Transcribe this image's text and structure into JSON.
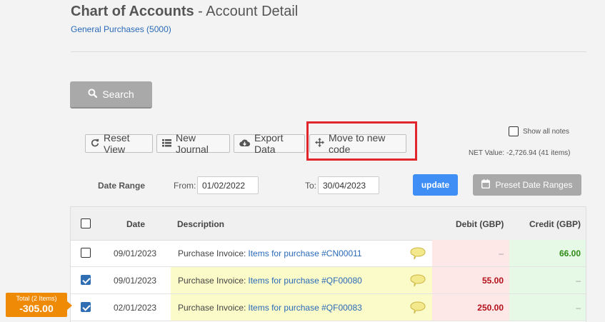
{
  "header": {
    "title_bold": "Chart of Accounts",
    "title_rest": " - Account Detail",
    "subtitle": "General Purchases (5000)"
  },
  "search": {
    "label": "Search",
    "icon": "search-icon"
  },
  "toolbar": {
    "reset_view": "Reset View",
    "new_journal": "New Journal",
    "export_data": "Export Data",
    "move_code": "Move to new code"
  },
  "notes": {
    "show_all_label": "Show all notes",
    "checked": false
  },
  "net_value": "NET Value: -2,726.94 (41 items)",
  "date_range": {
    "label": "Date Range",
    "from_label": "From:",
    "from_value": "01/02/2022",
    "to_label": "To:",
    "to_value": "30/04/2023",
    "update_label": "update",
    "preset_label": "Preset Date Ranges"
  },
  "table": {
    "headers": {
      "date": "Date",
      "description": "Description",
      "debit": "Debit (GBP)",
      "credit": "Credit (GBP)"
    },
    "rows": [
      {
        "date": "09/01/2023",
        "desc_prefix": "Purchase Invoice:",
        "desc_link": "Items for purchase #CN00011",
        "debit": "–",
        "credit": "66.00",
        "checked": false
      },
      {
        "date": "09/01/2023",
        "desc_prefix": "Purchase Invoice:",
        "desc_link": "Items for purchase #QF00080",
        "debit": "55.00",
        "credit": "–",
        "checked": true
      },
      {
        "date": "02/01/2023",
        "desc_prefix": "Purchase Invoice:",
        "desc_link": "Items for purchase #QF00083",
        "debit": "250.00",
        "credit": "–",
        "checked": true
      }
    ]
  },
  "total": {
    "label": "Total (2 Items)",
    "value": "-305.00"
  },
  "colors": {
    "accent_blue": "#3e8ef5",
    "highlight_red": "#e0252c",
    "total_orange": "#ef8a07",
    "debit_red": "#b3101a",
    "credit_green": "#2f8c16"
  }
}
